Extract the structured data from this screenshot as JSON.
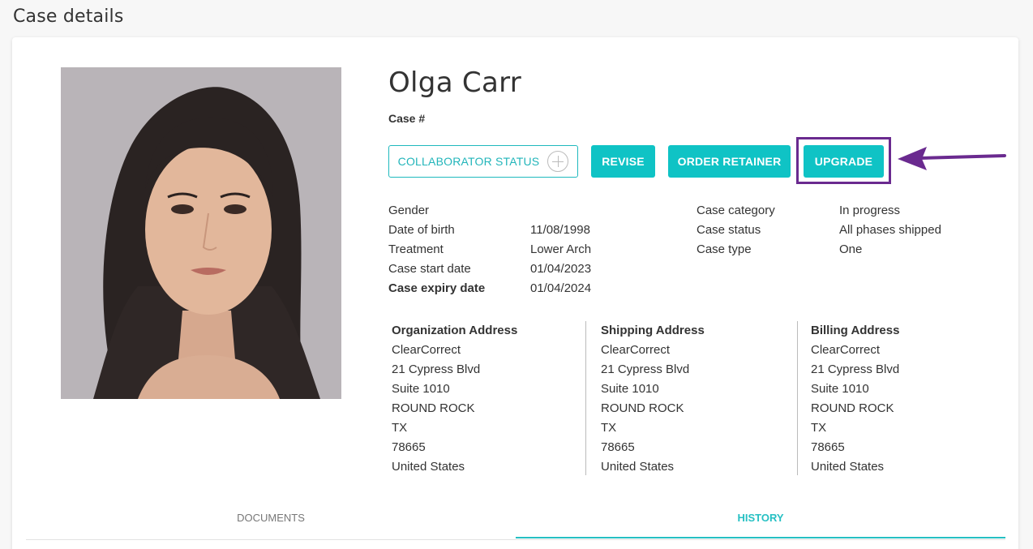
{
  "page": {
    "title": "Case details"
  },
  "patient": {
    "name": "Olga Carr",
    "case_number_label": "Case #"
  },
  "actions": {
    "collaborator_status": "COLLABORATOR STATUS",
    "revise": "REVISE",
    "order_retainer": "ORDER RETAINER",
    "upgrade": "UPGRADE"
  },
  "details_left": {
    "labels": [
      "Gender",
      "Date of birth",
      "Treatment",
      "Case start date",
      "Case expiry date"
    ],
    "values": [
      "11/08/1998",
      "Lower Arch",
      "01/04/2023",
      "01/04/2024"
    ]
  },
  "details_right": {
    "labels": [
      "Case category",
      "Case status",
      "Case type"
    ],
    "values": [
      "In progress",
      "All phases shipped",
      "One"
    ]
  },
  "addresses": [
    {
      "title": "Organization Address",
      "lines": [
        "ClearCorrect",
        "21 Cypress Blvd",
        "Suite 1010",
        "ROUND ROCK",
        "TX",
        "78665",
        "United States"
      ]
    },
    {
      "title": "Shipping Address",
      "lines": [
        "ClearCorrect",
        "21 Cypress Blvd",
        "Suite 1010",
        "ROUND ROCK",
        "TX",
        "78665",
        "United States"
      ]
    },
    {
      "title": "Billing Address",
      "lines": [
        "ClearCorrect",
        "21 Cypress Blvd",
        "Suite 1010",
        "ROUND ROCK",
        "TX",
        "78665",
        "United States"
      ]
    }
  ],
  "tabs": [
    {
      "label": "DOCUMENTS",
      "active": false
    },
    {
      "label": "HISTORY",
      "active": true
    }
  ],
  "colors": {
    "accent": "#0fc3c5",
    "highlight": "#6a2a8f"
  },
  "icons": {
    "collaborator_add": "plus-circle-icon",
    "pointer": "arrow-left-icon"
  }
}
